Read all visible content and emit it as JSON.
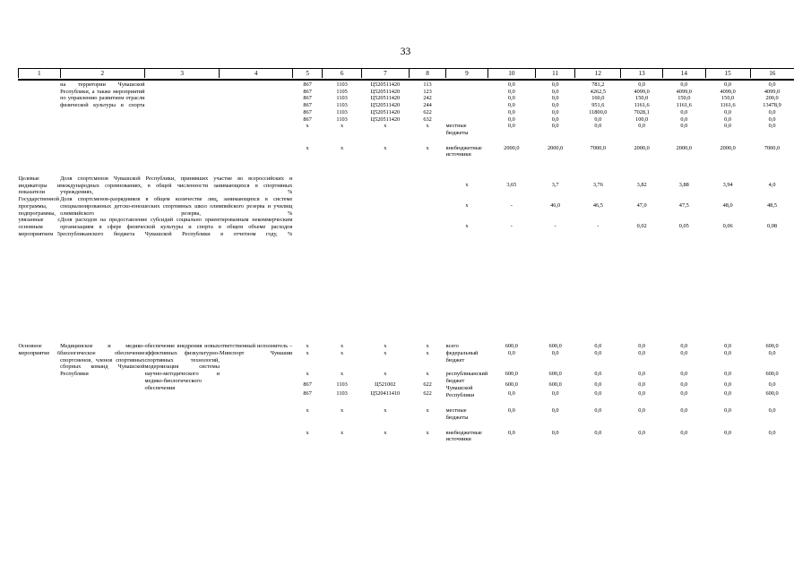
{
  "page": {
    "number": "33"
  },
  "table": {
    "column_numbers": [
      "1",
      "2",
      "3",
      "4",
      "5",
      "6",
      "7",
      "8",
      "9",
      "10",
      "11",
      "12",
      "13",
      "14",
      "15",
      "16"
    ],
    "block1": {
      "col2_text": "на территории Чувашской Республики, а также мероприятий по управлению развитием отрасли физической культуры и спорта",
      "rows": [
        {
          "c5": "867",
          "c6": "1103",
          "c7": "Ц520511420",
          "c8": "113",
          "c9": "",
          "c10": "0,0",
          "c11": "0,0",
          "c12": "781,2",
          "c13": "0,0",
          "c14": "0,0",
          "c15": "0,0",
          "c16": "0,0"
        },
        {
          "c5": "867",
          "c6": "1105",
          "c7": "Ц520511420",
          "c8": "123",
          "c9": "",
          "c10": "0,0",
          "c11": "0,0",
          "c12": "4262,5",
          "c13": "4099,0",
          "c14": "4099,0",
          "c15": "4099,0",
          "c16": "4099,0"
        },
        {
          "c5": "867",
          "c6": "1103",
          "c7": "Ц520511420",
          "c8": "242",
          "c9": "",
          "c10": "0,0",
          "c11": "0,0",
          "c12": "160,0",
          "c13": "150,0",
          "c14": "150,0",
          "c15": "150,0",
          "c16": "200,0"
        },
        {
          "c5": "867",
          "c6": "1103",
          "c7": "Ц520511420",
          "c8": "244",
          "c9": "",
          "c10": "0,0",
          "c11": "0,0",
          "c12": "951,6",
          "c13": "1161,6",
          "c14": "1161,6",
          "c15": "1161,6",
          "c16": "13478,9"
        },
        {
          "c5": "867",
          "c6": "1103",
          "c7": "Ц520511420",
          "c8": "622",
          "c9": "",
          "c10": "0,0",
          "c11": "0,0",
          "c12": "11800,0",
          "c13": "7028,1",
          "c14": "0,0",
          "c15": "0,0",
          "c16": "0,0"
        },
        {
          "c5": "867",
          "c6": "1103",
          "c7": "Ц520511420",
          "c8": "632",
          "c9": "",
          "c10": "0,0",
          "c11": "0,0",
          "c12": "0,0",
          "c13": "100,0",
          "c14": "0,0",
          "c15": "0,0",
          "c16": "0,0"
        },
        {
          "c5": "х",
          "c6": "х",
          "c7": "х",
          "c8": "х",
          "c9": "местные бюджеты",
          "c10": "0,0",
          "c11": "0,0",
          "c12": "0,0",
          "c13": "0,0",
          "c14": "0,0",
          "c15": "0,0",
          "c16": "0,0"
        },
        {
          "c5": "х",
          "c6": "х",
          "c7": "х",
          "c8": "х",
          "c9": "внебюджетные источники",
          "c10": "2000,0",
          "c11": "2000,0",
          "c12": "7000,0",
          "c13": "2000,0",
          "c14": "2000,0",
          "c15": "2000,0",
          "c16": "7000,0"
        }
      ]
    },
    "block2": {
      "col1_text": "Целевые индикаторы и показатели Государственной программы, подпрограммы, увязанные с основным мероприятием 5",
      "indicators": [
        {
          "text": "Доля спортсменов Чувашской Республики, принявших участие во всероссийских и международных соревнованиях, в общей численности занимающихся в спортивных учреждениях, %",
          "c5": "х",
          "c10": "3,65",
          "c11": "3,7",
          "c12": "3,76",
          "c13": "3,82",
          "c14": "3,88",
          "c15": "3,94",
          "c16": "4,0"
        },
        {
          "text": "Доля спортсменов-разрядников в общем количестве лиц, занимающихся в системе специализированных детско-юношеских спортивных школ олимпийского резерва и училищ олимпийского резерва, %",
          "c5": "х",
          "c10": "-",
          "c11": "46,0",
          "c12": "46,5",
          "c13": "47,0",
          "c14": "47,5",
          "c15": "48,0",
          "c16": "48,5"
        },
        {
          "text": "Доля расходов на предоставление субсидий социально ориентированным некоммерческим организациям в сфере физической культуры и спорта в общем объеме расходов республиканского бюджета Чувашской Республики в отчетном году, %",
          "c5": "х",
          "c10": "-",
          "c11": "-",
          "c12": "-",
          "c13": "0,02",
          "c14": "0,05",
          "c15": "0,06",
          "c16": "0,08"
        }
      ]
    },
    "block3": {
      "col1_text": "Основное мероприятие 6",
      "col2_text": "Медицинское и медико-биологическое обеспечение спортсменов, членов спортивных сборных команд Чувашской Республики",
      "col3_text": "обеспечение внедрения новых эффективных физкультурно-спортивных технологий, модернизация системы научно-методического и медико-биологического обеспечения",
      "col4_text": "ответственный исполнитель – Минспорт Чувашии",
      "rows": [
        {
          "c5": "х",
          "c6": "х",
          "c7": "х",
          "c8": "х",
          "c9": "всего",
          "c10": "600,0",
          "c11": "600,0",
          "c12": "0,0",
          "c13": "0,0",
          "c14": "0,0",
          "c15": "0,0",
          "c16": "600,0"
        },
        {
          "c5": "х",
          "c6": "х",
          "c7": "х",
          "c8": "х",
          "c9": "федеральный бюджет",
          "c10": "0,0",
          "c11": "0,0",
          "c12": "0,0",
          "c13": "0,0",
          "c14": "0,0",
          "c15": "0,0",
          "c16": "0,0"
        },
        {
          "c5": "х",
          "c6": "х",
          "c7": "х",
          "c8": "х",
          "c9": "республиканский бюджет Чувашской Республики",
          "c10": "600,0",
          "c11": "600,0",
          "c12": "0,0",
          "c13": "0,0",
          "c14": "0,0",
          "c15": "0,0",
          "c16": "600,0"
        },
        {
          "c5": "867",
          "c6": "1103",
          "c7": "Ц521002",
          "c8": "622",
          "c9": "",
          "c10": "600,0",
          "c11": "600,0",
          "c12": "0,0",
          "c13": "0,0",
          "c14": "0,0",
          "c15": "0,0",
          "c16": "0,0"
        },
        {
          "c5": "867",
          "c6": "1103",
          "c7": "Ц520411410",
          "c8": "622",
          "c9": "",
          "c10": "0,0",
          "c11": "0,0",
          "c12": "0,0",
          "c13": "0,0",
          "c14": "0,0",
          "c15": "0,0",
          "c16": "600,0"
        },
        {
          "c5": "х",
          "c6": "х",
          "c7": "х",
          "c8": "х",
          "c9": "местные бюджеты",
          "c10": "0,0",
          "c11": "0,0",
          "c12": "0,0",
          "c13": "0,0",
          "c14": "0,0",
          "c15": "0,0",
          "c16": "0,0"
        },
        {
          "c5": "х",
          "c6": "х",
          "c7": "х",
          "c8": "х",
          "c9": "внебюджетные источники",
          "c10": "0,0",
          "c11": "0,0",
          "c12": "0,0",
          "c13": "0,0",
          "c14": "0,0",
          "c15": "0,0",
          "c16": "0,0"
        }
      ]
    }
  }
}
